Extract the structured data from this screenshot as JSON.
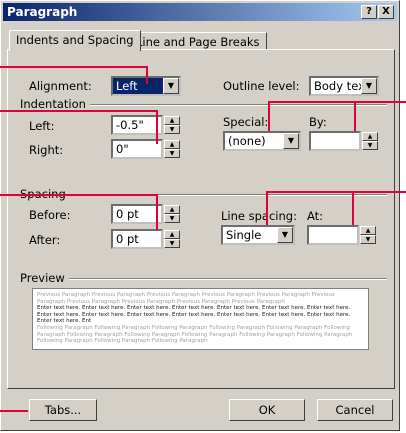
{
  "window": {
    "title": "Paragraph",
    "help_btn": "?",
    "close_btn": "X"
  },
  "tabs": [
    {
      "label": "Indents and Spacing",
      "active": true
    },
    {
      "label": "Line and Page Breaks",
      "active": false
    }
  ],
  "general": {
    "alignment_label": "Alignment:",
    "alignment_value": "Left",
    "outline_label": "Outline level:",
    "outline_value": "Body text"
  },
  "indentation": {
    "group_label": "Indentation",
    "left_label": "Left:",
    "left_value": "-0.5\"",
    "right_label": "Right:",
    "right_value": "0\"",
    "special_label": "Special:",
    "special_value": "(none)",
    "by_label": "By:",
    "by_value": ""
  },
  "spacing": {
    "group_label": "Spacing",
    "before_label": "Before:",
    "before_value": "0 pt",
    "after_label": "After:",
    "after_value": "0 pt",
    "line_spacing_label": "Line spacing:",
    "line_spacing_value": "Single",
    "at_label": "At:",
    "at_value": ""
  },
  "preview": {
    "group_label": "Preview",
    "previous_text": "Previous Paragraph Previous Paragraph Previous Paragraph Previous Paragraph Previous Paragraph Previous Paragraph Previous Paragraph Previous Paragraph Previous Paragraph Previous Paragraph",
    "sample_text": "Enter text here.  Enter text here.  Enter text here.  Enter text here.  Enter text here.  Enter text here.  Enter text here.  Enter text here.  Enter text here.  Enter text here.  Enter text here.  Enter text here.  Enter text here.  Enter text here.  Enter text here.  Ent",
    "following_text": "Following Paragraph Following Paragraph Following Paragraph Following Paragraph Following Paragraph Following Paragraph Following Paragraph Following Paragraph Following Paragraph Following Paragraph Following Paragraph Following Paragraph Following Paragraph Following Paragraph"
  },
  "buttons": {
    "tabs": "Tabs...",
    "ok": "OK",
    "cancel": "Cancel"
  },
  "colors": {
    "title_start": "#0a246a",
    "title_end": "#a6caf0",
    "callout": "#e0003c",
    "face": "#d4d0c8"
  }
}
